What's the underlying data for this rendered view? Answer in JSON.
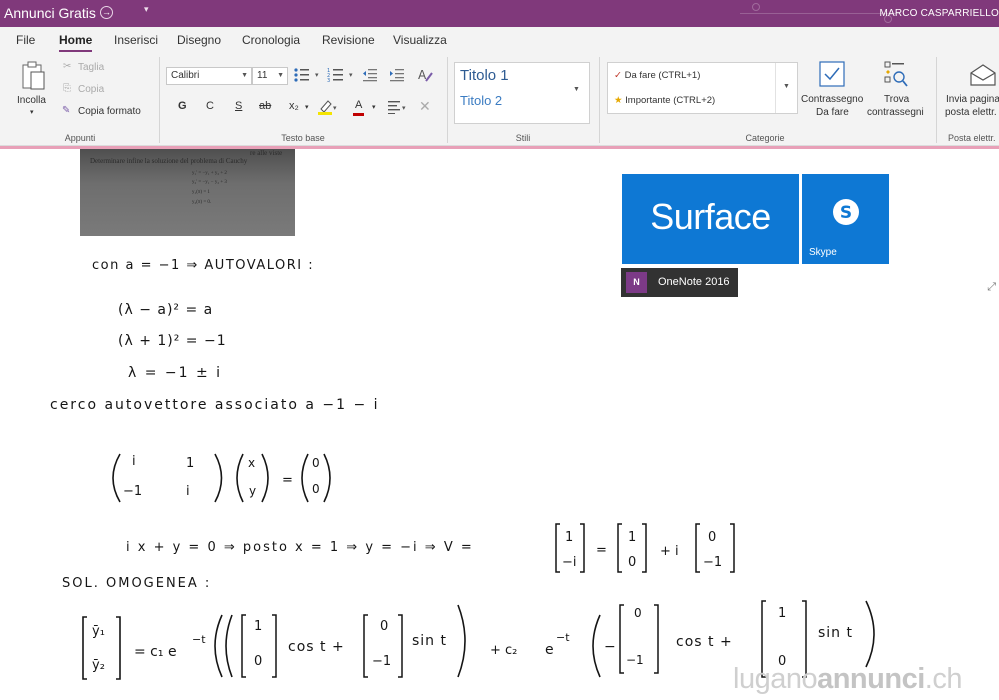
{
  "titlebar": {
    "app_title": "Annunci Gratis",
    "user_name": "MARCO CASPARRIELLO"
  },
  "tabs": [
    {
      "label": "File"
    },
    {
      "label": "Home"
    },
    {
      "label": "Inserisci"
    },
    {
      "label": "Disegno"
    },
    {
      "label": "Cronologia"
    },
    {
      "label": "Revisione"
    },
    {
      "label": "Visualizza"
    }
  ],
  "ribbon": {
    "appunti": {
      "paste": "Incolla",
      "cut": "Taglia",
      "copy": "Copia",
      "format_painter": "Copia formato",
      "label": "Appunti"
    },
    "testo_base": {
      "font_name": "Calibri",
      "font_size": "11",
      "bold": "G",
      "italic": "C",
      "underline": "S",
      "strike": "ab",
      "subscript": "x₂",
      "font_color_letter": "A",
      "label": "Testo base"
    },
    "stili": {
      "heading1": "Titolo 1",
      "heading2": "Titolo 2",
      "label": "Stili"
    },
    "categorie": {
      "todo": "Da fare (CTRL+1)",
      "important": "Importante (CTRL+2)",
      "todo_tag_line1": "Contrassegno",
      "todo_tag_line2": "Da fare",
      "find_tags_line1": "Trova",
      "find_tags_line2": "contrassegni",
      "label": "Categorie"
    },
    "email": {
      "line1": "Invia pagina",
      "line2": "posta elettr.",
      "label": "Posta elettr."
    },
    "colors": {
      "accent": "#80397b",
      "tile_blue": "#0e78d4"
    }
  },
  "page": {
    "photo_lines": [
      "Determinare infine la soluzione del problema di Cauchy",
      "y₁' = −y₁ + y₂ + 2",
      "y₂' = −y₁ − y₂ + 3",
      "y₁(π) = 1",
      "y₂(π) = 0."
    ],
    "photo_top_right": "re alle viste ",
    "tiles": {
      "surface": "Surface",
      "skype": "Skype",
      "onenote": "OneNote 2016",
      "onenote_icon": "N"
    },
    "ink": {
      "line1": "con  a = −1   ⇒  AUTOVALORI :",
      "eq1": "(λ − a)² = a",
      "eq2": "(λ + 1)² = −1",
      "eq3": "λ = −1 ± i",
      "line2": "cerco  autovettore  associato  a   −1 − i",
      "m_a": "i",
      "m_b": "1",
      "m_c": "−1",
      "m_d": "i",
      "v_x": "x",
      "v_y": "y",
      "eq_zero": "=",
      "z1": "0",
      "z2": "0",
      "line3a": "i x  + y = 0    ⇒   posto    x = 1   ⇒  y = −i    ⇒  V =",
      "v1a": "1",
      "v1b": "−i",
      "eq_v": "=",
      "v2a": "1",
      "v2b": "0",
      "plus_i": "+ i",
      "v3a": "0",
      "v3b": "−1",
      "sol_title": "SOL. OMOGENEA :",
      "y1": "ȳ₁",
      "y2": "ȳ₂",
      "sol_eq": "=  c₁  e",
      "exp1": "−t",
      "s_v1a": "1",
      "s_v1b": "0",
      "cost1": "cos t   +",
      "s_v2a": "0",
      "s_v2b": "−1",
      "sint1": "sin t",
      "plus_c2": "+  c₂",
      "e2": "e",
      "exp2": "−t",
      "minus": "−",
      "s_v3a": "0",
      "s_v3b": "−1",
      "cost2": "cos t     +",
      "s_v4a": "1",
      "s_v4b": "0",
      "sint2": "sin t"
    },
    "watermark_a": "lugano",
    "watermark_b": "annunci",
    "watermark_c": ".ch"
  }
}
